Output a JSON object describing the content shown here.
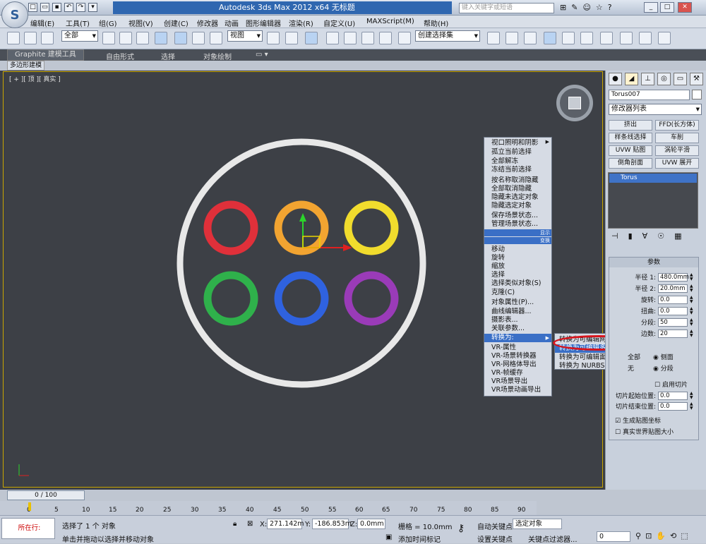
{
  "window": {
    "title": "Autodesk 3ds Max  2012 x64      无标题",
    "search_placeholder": "键入关键字或短语"
  },
  "menu": [
    "编辑(E)",
    "工具(T)",
    "组(G)",
    "视图(V)",
    "创建(C)",
    "修改器",
    "动画",
    "图形编辑器",
    "渲染(R)",
    "自定义(U)",
    "MAXScript(M)",
    "帮助(H)"
  ],
  "toolbar": {
    "selection_filter": "全部",
    "ref_coord": "视图",
    "named_selection": "创建选择集"
  },
  "ribbon": {
    "tabs": [
      "Graphite 建模工具",
      "自由形式",
      "选择",
      "对象绘制"
    ],
    "subtab": "多边形建模"
  },
  "viewport": {
    "label": "[ + ][ 顶 ][ 真实 ]"
  },
  "context_menu": {
    "items": [
      "视口照明和阴影",
      "孤立当前选择",
      "全部解冻",
      "冻结当前选择",
      "按名称取消隐藏",
      "全部取消隐藏",
      "隐藏未选定对象",
      "隐藏选定对象",
      "保存场景状态...",
      "管理场景状态...",
      "显示",
      "变换",
      "移动",
      "旋转",
      "缩放",
      "选择",
      "选择类似对象(S)",
      "克隆(C)",
      "对象属性(P)...",
      "曲线编辑器...",
      "摄影表...",
      "关联参数...",
      "转换为:",
      "VR-属性",
      "VR-场景转换器",
      "VR-网格体导出",
      "VR-帧缓存",
      "VR场景导出",
      "VR场景动画导出"
    ],
    "submenu": [
      "转换为可编辑网格",
      "转换为可编辑多边形",
      "转换为可编辑面片",
      "转换为 NURBS"
    ]
  },
  "command_panel": {
    "object_name": "Torus007",
    "modifier_list": "修改器列表",
    "modifier_buttons": [
      "挤出",
      "FFD(长方体)",
      "样条线选择",
      "车削",
      "UVW 贴图",
      "涡轮平滑",
      "倒角剖面",
      "UVW 展开"
    ],
    "stack_item": "Torus",
    "params_title": "参数",
    "params": [
      {
        "label": "半径 1:",
        "value": "480.0mm"
      },
      {
        "label": "半径 2:",
        "value": "20.0mm"
      },
      {
        "label": "旋转:",
        "value": "0.0"
      },
      {
        "label": "扭曲:",
        "value": "0.0"
      },
      {
        "label": "分段:",
        "value": "50"
      },
      {
        "label": "边数:",
        "value": "20"
      }
    ],
    "smooth_all": "全部",
    "smooth_side": "侧面",
    "smooth_none": "无",
    "smooth_segment": "分段",
    "slice_on": "启用切片",
    "slice_from_label": "切片起始位置:",
    "slice_from": "0.0",
    "slice_to_label": "切片结束位置:",
    "slice_to": "0.0",
    "gen_mapping": "生成贴图坐标",
    "real_world": "真实世界贴图大小"
  },
  "timeline": {
    "frame": "0 / 100",
    "ticks": [
      "0",
      "5",
      "10",
      "15",
      "20",
      "25",
      "30",
      "35",
      "40",
      "45",
      "50",
      "55",
      "60",
      "65",
      "70",
      "75",
      "80",
      "85",
      "90"
    ]
  },
  "status": {
    "mode": "所在行:",
    "selected": "选择了 1 个 对象",
    "hint": "单击并拖动以选择并移动对象",
    "x_label": "X:",
    "x": "271.142m",
    "y_label": "Y:",
    "y": "-186.853m",
    "z_label": "Z:",
    "z": "0.0mm",
    "grid": "栅格 = 10.0mm",
    "add_tag": "添加时间标记",
    "autokey": "自动关键点",
    "selected_obj": "选定对象",
    "setkey": "设置关键点",
    "key_filters": "关键点过滤器...",
    "frame_field": "0"
  }
}
